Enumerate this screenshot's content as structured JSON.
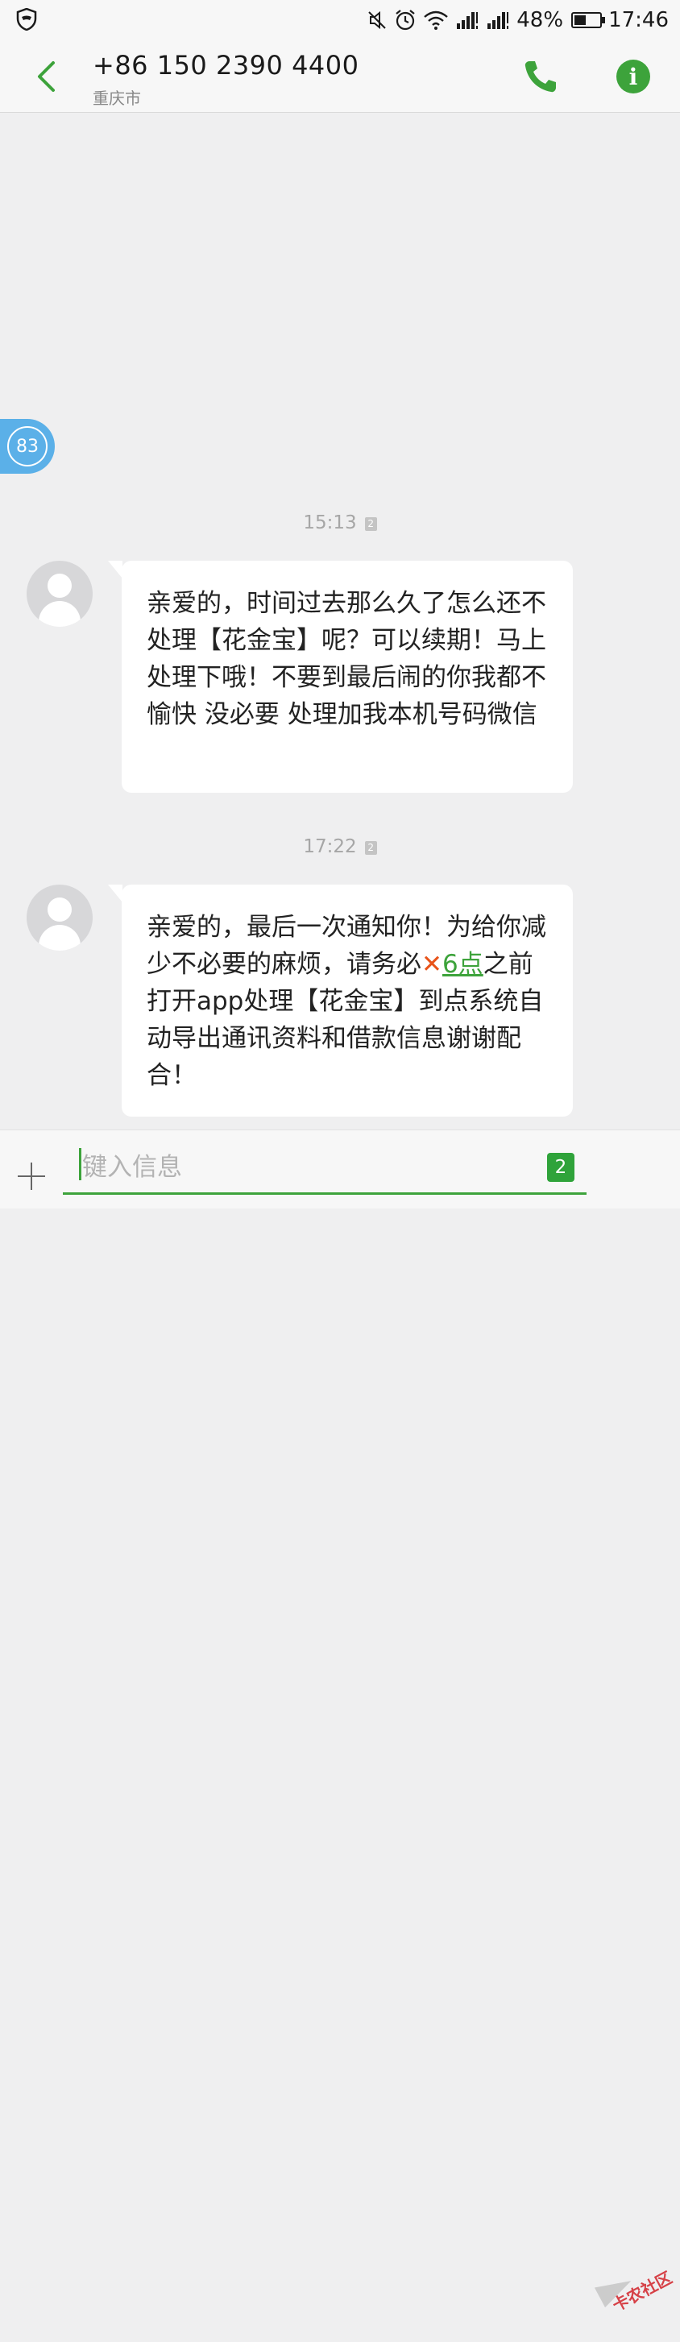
{
  "status_bar": {
    "battery": "48%",
    "battery_level": 0.48,
    "time": "17:46",
    "icons": [
      "shield-icon",
      "mute-icon",
      "alarm-icon",
      "wifi-icon",
      "signal-icon",
      "signal-icon",
      "battery-icon"
    ]
  },
  "header": {
    "number": "+86 150 2390 4400",
    "location": "重庆市",
    "icons": [
      "back-arrow-icon",
      "phone-icon",
      "info-icon"
    ],
    "info_glyph": "i",
    "accent": "#3da33b"
  },
  "floating_badge": {
    "count": "83"
  },
  "messages": [
    {
      "time": "15:13",
      "sim": "2",
      "text": "亲爱的，时间过去那么久了怎么还不处理【花金宝】呢？可以续期！马上处理下哦！不要到最后闹的你我都不愉快 没必要 处理加我本机号码微信"
    },
    {
      "time": "17:22",
      "sim": "2",
      "text_before": "亲爱的，最后一次通知你！为给你减少不必要的麻烦，请务必",
      "mark": "✕",
      "link": "6点",
      "text_after": "之前打开app处理【花金宝】到点系统自动导出通讯资料和借款信息谢谢配合！"
    }
  ],
  "composer": {
    "placeholder": "键入信息",
    "sim_label": "2",
    "watermark": "卡农社区"
  }
}
